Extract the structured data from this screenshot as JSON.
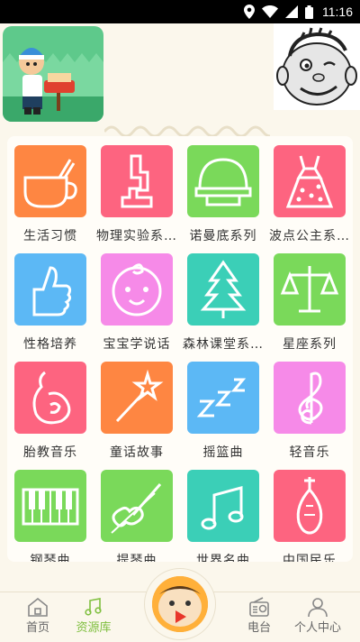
{
  "status_bar": {
    "time": "11:16",
    "icons": [
      "location-icon",
      "wifi-icon",
      "cell-signal-icon",
      "battery-icon"
    ]
  },
  "grid": {
    "items": [
      {
        "label": "生活习惯",
        "color": "#fe8642",
        "icon": "cup-icon"
      },
      {
        "label": "物理实验系…",
        "color": "#fd6480",
        "icon": "microscope-icon"
      },
      {
        "label": "诺曼底系列",
        "color": "#7ad95a",
        "icon": "helmet-icon"
      },
      {
        "label": "波点公主系…",
        "color": "#fd6480",
        "icon": "dress-icon"
      },
      {
        "label": "性格培养",
        "color": "#5cb8f5",
        "icon": "thumbs-up-icon"
      },
      {
        "label": "宝宝学说话",
        "color": "#f68ae8",
        "icon": "baby-face-icon"
      },
      {
        "label": "森林课堂系…",
        "color": "#3bcfb7",
        "icon": "tree-icon"
      },
      {
        "label": "星座系列",
        "color": "#7ad95a",
        "icon": "scales-icon"
      },
      {
        "label": "胎教音乐",
        "color": "#fd6480",
        "icon": "pregnant-icon"
      },
      {
        "label": "童话故事",
        "color": "#fe8642",
        "icon": "magic-wand-icon"
      },
      {
        "label": "摇篮曲",
        "color": "#5cb8f5",
        "icon": "sleep-zzz-icon"
      },
      {
        "label": "轻音乐",
        "color": "#f68ae8",
        "icon": "treble-clef-icon"
      },
      {
        "label": "钢琴曲",
        "color": "#7ad95a",
        "icon": "piano-icon"
      },
      {
        "label": "提琴曲",
        "color": "#7ad95a",
        "icon": "violin-icon"
      },
      {
        "label": "世界名曲",
        "color": "#3bcfb7",
        "icon": "music-note-icon"
      },
      {
        "label": "中国民乐",
        "color": "#fd6480",
        "icon": "pipa-icon"
      }
    ]
  },
  "nav": {
    "home": "首页",
    "library": "资源库",
    "radio": "电台",
    "profile": "个人中心",
    "active_color": "#7fbf3f"
  }
}
